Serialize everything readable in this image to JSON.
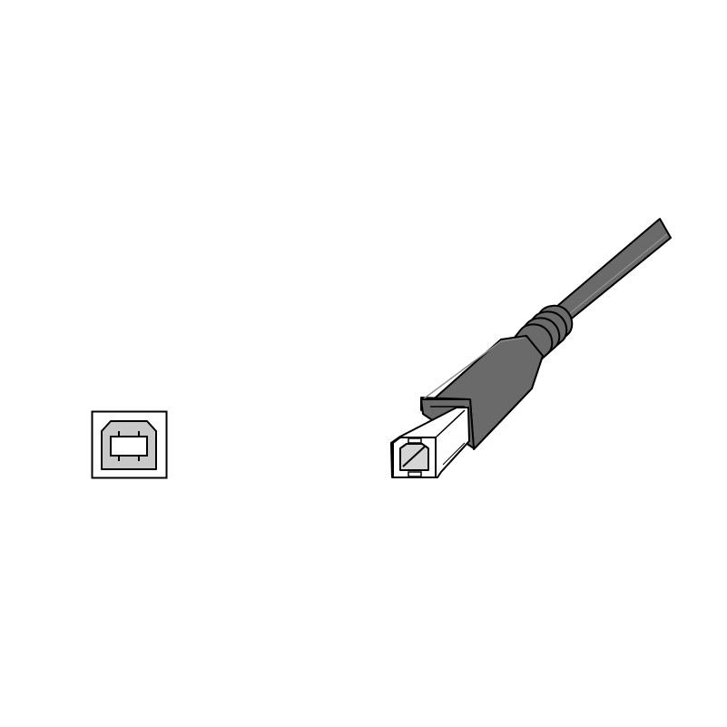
{
  "figure": {
    "background_color": "#ffffff",
    "outline_color": "#000000",
    "parts": [
      {
        "name": "usb-b-port-icon",
        "fill": "#c8c8c8"
      },
      {
        "name": "usb-b-cable-plug-icon",
        "fill": "#6a6a6a",
        "connector_fill": "#ffffff",
        "inner_fill": "#d4d4d4"
      }
    ]
  }
}
